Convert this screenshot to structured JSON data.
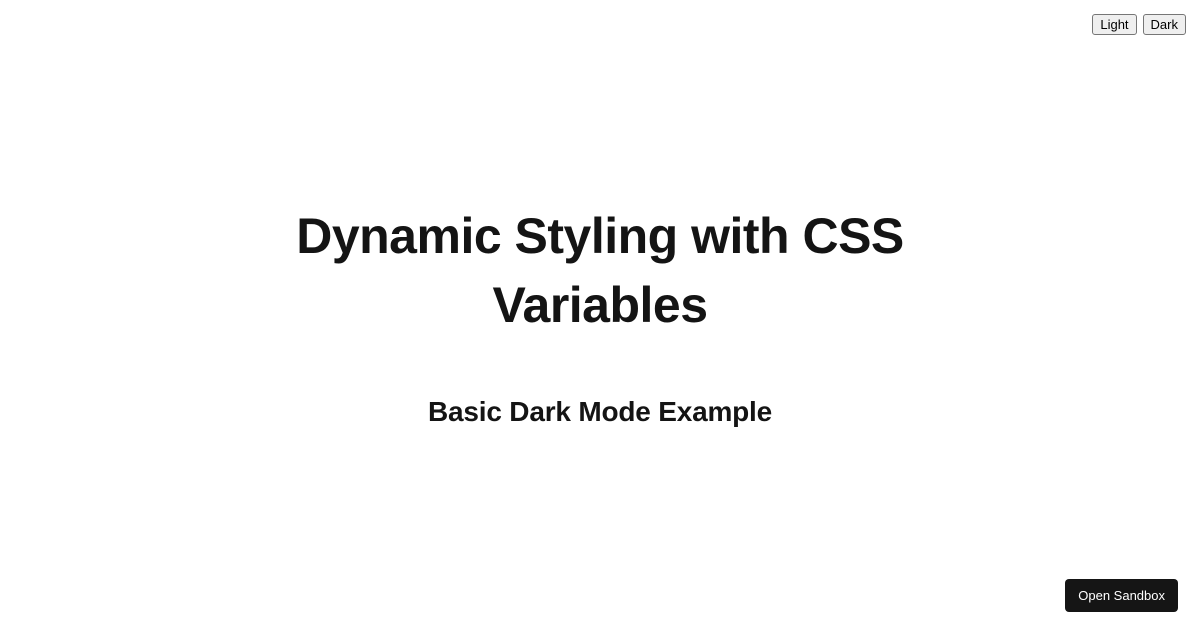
{
  "theme_toggle": {
    "light_label": "Light",
    "dark_label": "Dark"
  },
  "content": {
    "title": "Dynamic Styling with CSS Variables",
    "subtitle": "Basic Dark Mode Example"
  },
  "footer": {
    "sandbox_label": "Open Sandbox"
  }
}
